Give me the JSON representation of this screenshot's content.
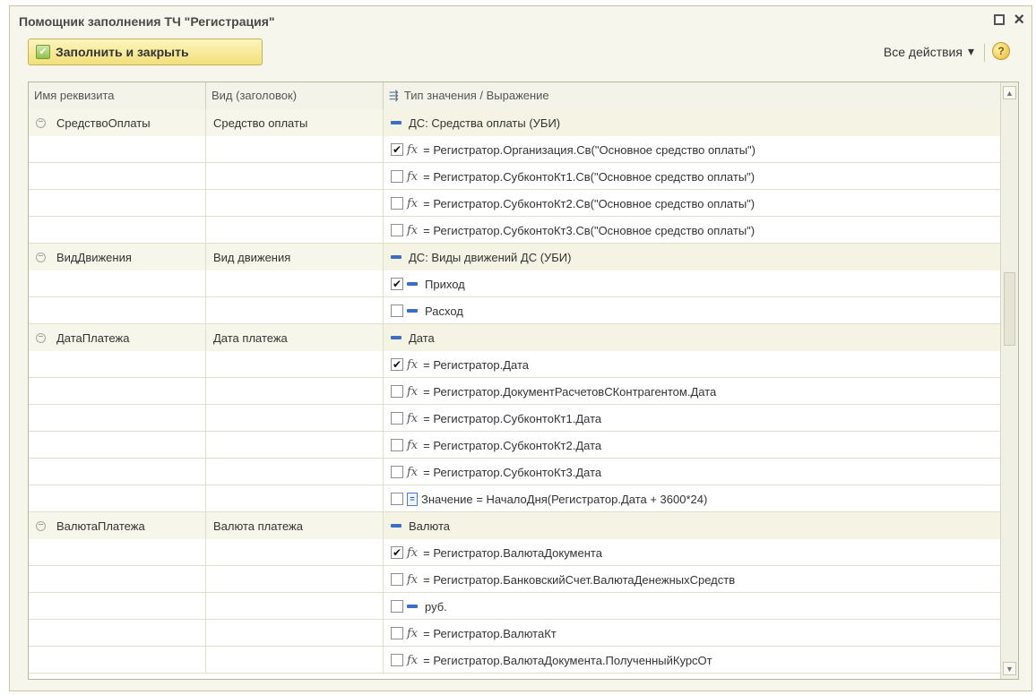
{
  "window": {
    "title": "Помощник заполнения ТЧ \"Регистрация\""
  },
  "toolbar": {
    "fill_close_label": "Заполнить и закрыть",
    "all_actions_label": "Все действия",
    "help_label": "?"
  },
  "table": {
    "headers": [
      "Имя реквизита",
      "Вид (заголовок)",
      "Тип значения / Выражение"
    ],
    "rows": [
      {
        "kind": "group",
        "name": "СредствоОплаты",
        "title": "Средство оплаты",
        "expr": "ДС: Средства оплаты (УБИ)",
        "icon": "dash"
      },
      {
        "kind": "item",
        "checked": true,
        "icon": "fx",
        "expr": "= Регистратор.Организация.Св(\"Основное средство оплаты\")"
      },
      {
        "kind": "item",
        "checked": false,
        "icon": "fx",
        "expr": "= Регистратор.СубконтоКт1.Св(\"Основное средство оплаты\")"
      },
      {
        "kind": "item",
        "checked": false,
        "icon": "fx",
        "expr": "= Регистратор.СубконтоКт2.Св(\"Основное средство оплаты\")"
      },
      {
        "kind": "item",
        "checked": false,
        "icon": "fx",
        "expr": "= Регистратор.СубконтоКт3.Св(\"Основное средство оплаты\")"
      },
      {
        "kind": "group",
        "name": "ВидДвижения",
        "title": "Вид движения",
        "expr": "ДС: Виды движений ДС (УБИ)",
        "icon": "dash"
      },
      {
        "kind": "item",
        "checked": true,
        "icon": "dash",
        "expr": "Приход"
      },
      {
        "kind": "item",
        "checked": false,
        "icon": "dash",
        "expr": "Расход"
      },
      {
        "kind": "group",
        "name": "ДатаПлатежа",
        "title": "Дата платежа",
        "expr": "Дата",
        "icon": "dash"
      },
      {
        "kind": "item",
        "checked": true,
        "icon": "fx",
        "expr": "= Регистратор.Дата"
      },
      {
        "kind": "item",
        "checked": false,
        "icon": "fx",
        "expr": "= Регистратор.ДокументРасчетовСКонтрагентом.Дата"
      },
      {
        "kind": "item",
        "checked": false,
        "icon": "fx",
        "expr": "= Регистратор.СубконтоКт1.Дата"
      },
      {
        "kind": "item",
        "checked": false,
        "icon": "fx",
        "expr": "= Регистратор.СубконтоКт2.Дата"
      },
      {
        "kind": "item",
        "checked": false,
        "icon": "fx",
        "expr": "= Регистратор.СубконтоКт3.Дата"
      },
      {
        "kind": "item",
        "checked": false,
        "icon": "value",
        "expr": "Значение = НачалоДня(Регистратор.Дата + 3600*24)"
      },
      {
        "kind": "group",
        "name": "ВалютаПлатежа",
        "title": "Валюта платежа",
        "expr": "Валюта",
        "icon": "dash"
      },
      {
        "kind": "item",
        "checked": true,
        "icon": "fx",
        "expr": "= Регистратор.ВалютаДокумента"
      },
      {
        "kind": "item",
        "checked": false,
        "icon": "fx",
        "expr": "= Регистратор.БанковскийСчет.ВалютаДенежныхСредств"
      },
      {
        "kind": "item",
        "checked": false,
        "icon": "dash",
        "expr": "руб."
      },
      {
        "kind": "item",
        "checked": false,
        "icon": "fx",
        "expr": "= Регистратор.ВалютаКт"
      },
      {
        "kind": "item",
        "checked": false,
        "icon": "fx",
        "expr": "= Регистратор.ВалютаДокумента.ПолученныйКурсОт"
      }
    ]
  },
  "symbols": {
    "fx": "fx",
    "check": "✔",
    "collapse": "−",
    "value_icon": "=",
    "scroll_up": "▲",
    "scroll_down": "▼",
    "dropdown": "▾",
    "close": "×"
  }
}
